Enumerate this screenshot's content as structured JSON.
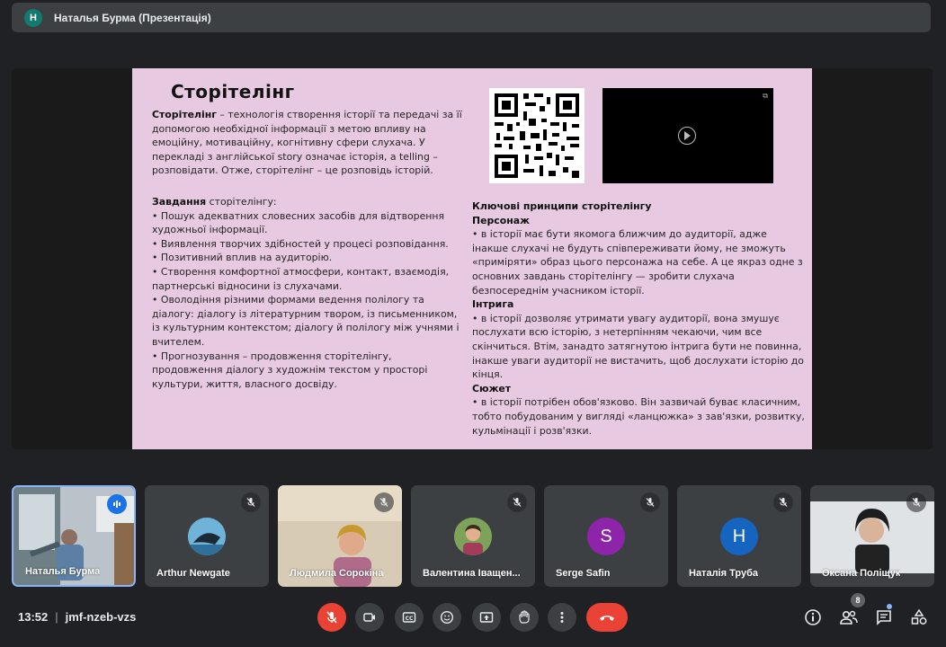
{
  "header": {
    "avatar_letter": "Н",
    "title": "Наталья Бурма (Презентація)"
  },
  "slide": {
    "title": "Сторітелінг",
    "intro_bold": "Сторітелінг",
    "intro_text": " – технологія створення історії та передачі за її допомогою необхідної інформації з метою впливу на емоційну, мотиваційну, когнітивну сфери слухача. У перекладі з англійської story означає історія, а telling – розповідати. Отже, сторітелінг – це розповідь історій.",
    "tasks_bold": "Завдання",
    "tasks_text": " сторітелінгу:",
    "tasks": [
      "• Пошук адекватних словесних засобів для відтворення художньої інформації.",
      "• Виявлення творчих здібностей у процесі розповідання.",
      "• Позитивний вплив на аудиторію.",
      "• Створення комфортної атмосфери, контакт, взаємодія, партнерські відносини із слухачами.",
      "• Оволодіння різними формами ведення полілогу та діалогу: діалогу із літературним твором, із письменником, із культурним контекстом; діалогу й полілогу між учнями і вчителем.",
      "• Прогнозування – продовження сторітелінгу, продовження діалогу з художнім текстом у просторі культури, життя, власного досвіду."
    ],
    "principles_title": "Ключові принципи сторітелінгу",
    "principles": [
      {
        "head": "Персонаж",
        "text": "• в історії має бути якомога ближчим до аудиторії, адже інакше слухачі не будуть співпереживати йому, не зможуть «приміряти» образ цього персонажа на себе. А це якраз одне з основних завдань сторітелінгу — зробити слухача безпосереднім учасником історії."
      },
      {
        "head": "Інтрига",
        "text": "• в історії дозволяє утримати увагу аудиторії, вона змушує послухати всю історію, з нетерпінням чекаючи, чим все скінчиться. Втім, занадто затягнутою інтрига бути не повинна, інакше уваги аудиторії не вистачить, щоб дослухати історію до кінця."
      },
      {
        "head": "Сюжет",
        "text": "• в історії потрібен обов'язково. Він зазвичай буває класичним, тобто побудованим у вигляді «ланцюжка» з зав'язки, розвитку, кульмінації і розв'язки."
      }
    ]
  },
  "participants": [
    {
      "name": "Наталья Бурма",
      "type": "video",
      "speaking": true
    },
    {
      "name": "Arthur Newgate",
      "type": "avatar-image",
      "color": "#4a8fb5"
    },
    {
      "name": "Людмила Сорокіна",
      "type": "video"
    },
    {
      "name": "Валентина Іващен...",
      "type": "avatar-image",
      "color": "#6b8c5a"
    },
    {
      "name": "Serge Safin",
      "type": "letter",
      "letter": "S",
      "color": "#8e24aa"
    },
    {
      "name": "Наталія Труба",
      "type": "letter",
      "letter": "Н",
      "color": "#1565c0"
    },
    {
      "name": "Оксана Поліщук",
      "type": "video"
    }
  ],
  "bottom": {
    "time": "13:52",
    "meeting_code": "jmf-nzeb-vzs",
    "participants_count": "8"
  },
  "colors": {
    "end_call": "#ea4335",
    "mic_off": "#ea4335",
    "active_border": "#8ab4f8"
  }
}
